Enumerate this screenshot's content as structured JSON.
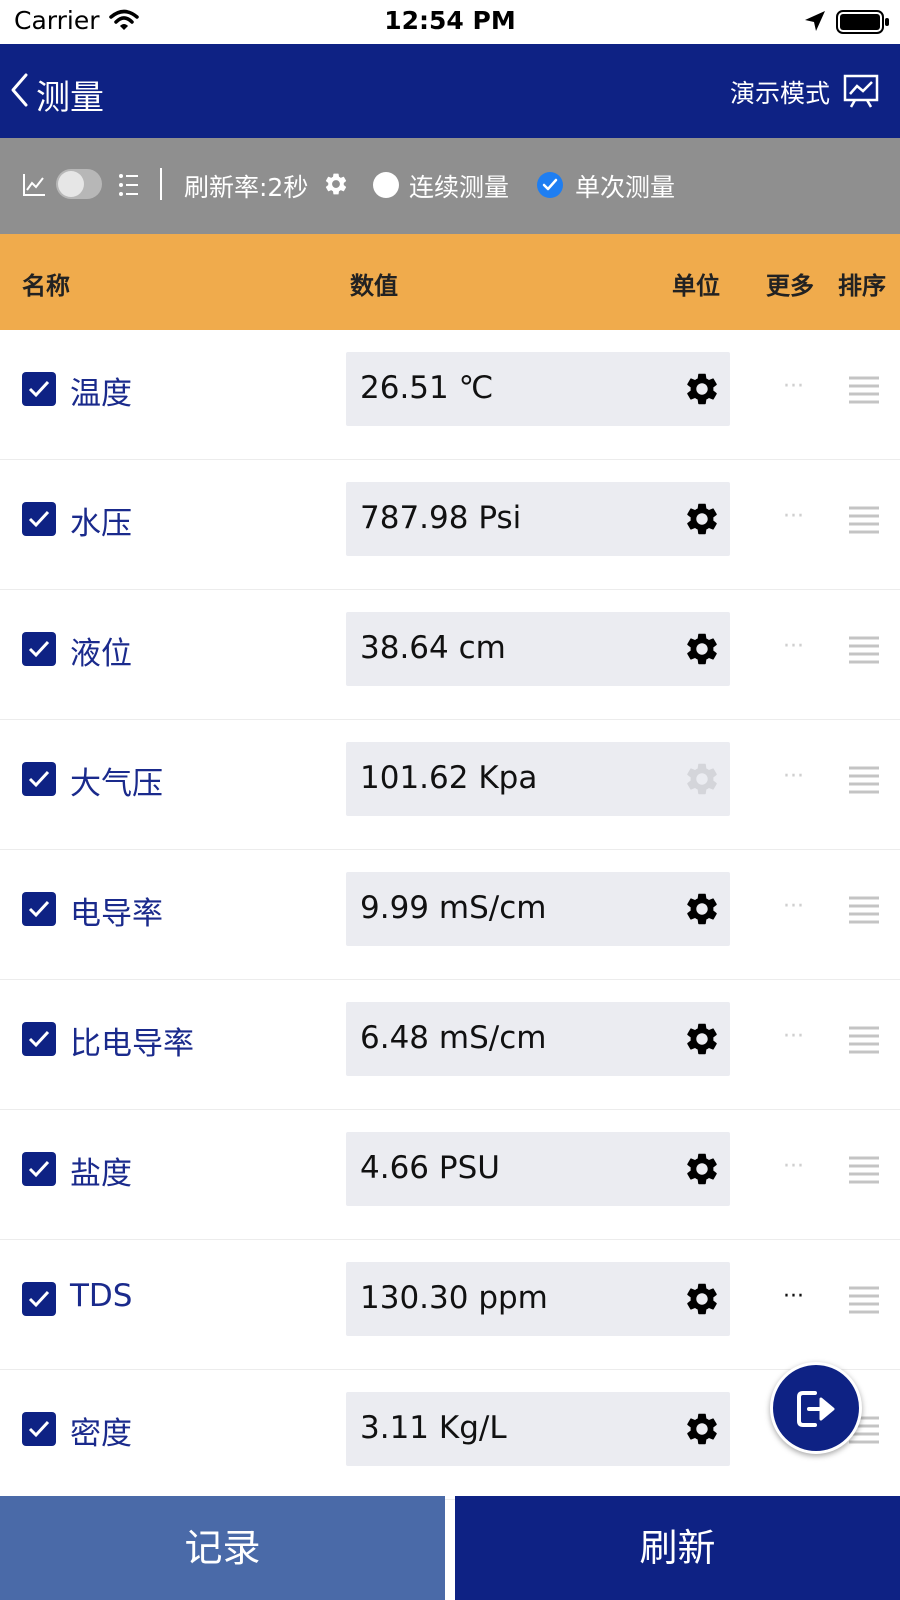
{
  "status_bar": {
    "carrier": "Carrier",
    "time": "12:54 PM"
  },
  "nav": {
    "title": "测量",
    "demo_label": "演示模式"
  },
  "toolbar": {
    "refresh_rate": "刷新率:2秒",
    "continuous_label": "连续测量",
    "single_label": "单次测量",
    "selected_mode": "单次测量"
  },
  "table": {
    "headers": {
      "name": "名称",
      "value": "数值",
      "unit": "单位",
      "more": "更多",
      "sort": "排序"
    },
    "rows": [
      {
        "name": "温度",
        "value": "26.51 ℃",
        "checked": true,
        "gear_enabled": true,
        "more_active": false
      },
      {
        "name": "水压",
        "value": "787.98 Psi",
        "checked": true,
        "gear_enabled": true,
        "more_active": false
      },
      {
        "name": "液位",
        "value": "38.64 cm",
        "checked": true,
        "gear_enabled": true,
        "more_active": false
      },
      {
        "name": "大气压",
        "value": "101.62 Kpa",
        "checked": true,
        "gear_enabled": false,
        "more_active": false
      },
      {
        "name": "电导率",
        "value": "9.99 mS/cm",
        "checked": true,
        "gear_enabled": true,
        "more_active": false
      },
      {
        "name": "比电导率",
        "value": "6.48 mS/cm",
        "checked": true,
        "gear_enabled": true,
        "more_active": false
      },
      {
        "name": "盐度",
        "value": "4.66 PSU",
        "checked": true,
        "gear_enabled": true,
        "more_active": false
      },
      {
        "name": "TDS",
        "value": "130.30 ppm",
        "checked": true,
        "gear_enabled": true,
        "more_active": true
      },
      {
        "name": "密度",
        "value": "3.11 Kg/L",
        "checked": true,
        "gear_enabled": true,
        "more_active": false
      }
    ],
    "more_glyph": "···"
  },
  "buttons": {
    "record": "记录",
    "refresh": "刷新"
  },
  "colors": {
    "primary": "#0e2284",
    "header": "#f0ab4c",
    "toolbar": "#8f8f8f",
    "record_button": "#4a6aa8",
    "radio_on": "#1e7ef2"
  }
}
